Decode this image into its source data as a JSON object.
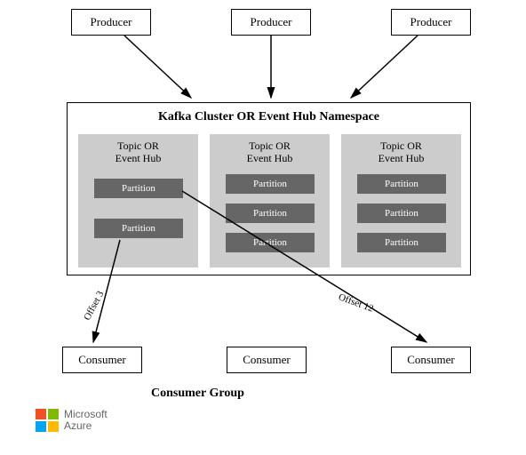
{
  "producers": [
    "Producer",
    "Producer",
    "Producer"
  ],
  "cluster": {
    "title": "Kafka Cluster OR Event Hub Namespace",
    "topics": [
      {
        "title": "Topic OR\nEvent Hub",
        "partitions": [
          "Partition",
          "Partition"
        ]
      },
      {
        "title": "Topic OR\nEvent Hub",
        "partitions": [
          "Partition",
          "Partition",
          "Partition"
        ]
      },
      {
        "title": "Topic OR\nEvent Hub",
        "partitions": [
          "Partition",
          "Partition",
          "Partition"
        ]
      }
    ]
  },
  "offsets": {
    "left": "Offset 3",
    "right": "Offset 12"
  },
  "consumers": [
    "Consumer",
    "Consumer",
    "Consumer"
  ],
  "consumer_group": "Consumer Group",
  "logo": {
    "brand": "Microsoft",
    "product": "Azure",
    "colors": {
      "tl": "#f25022",
      "tr": "#7fba00",
      "bl": "#00a4ef",
      "br": "#ffb900"
    }
  }
}
